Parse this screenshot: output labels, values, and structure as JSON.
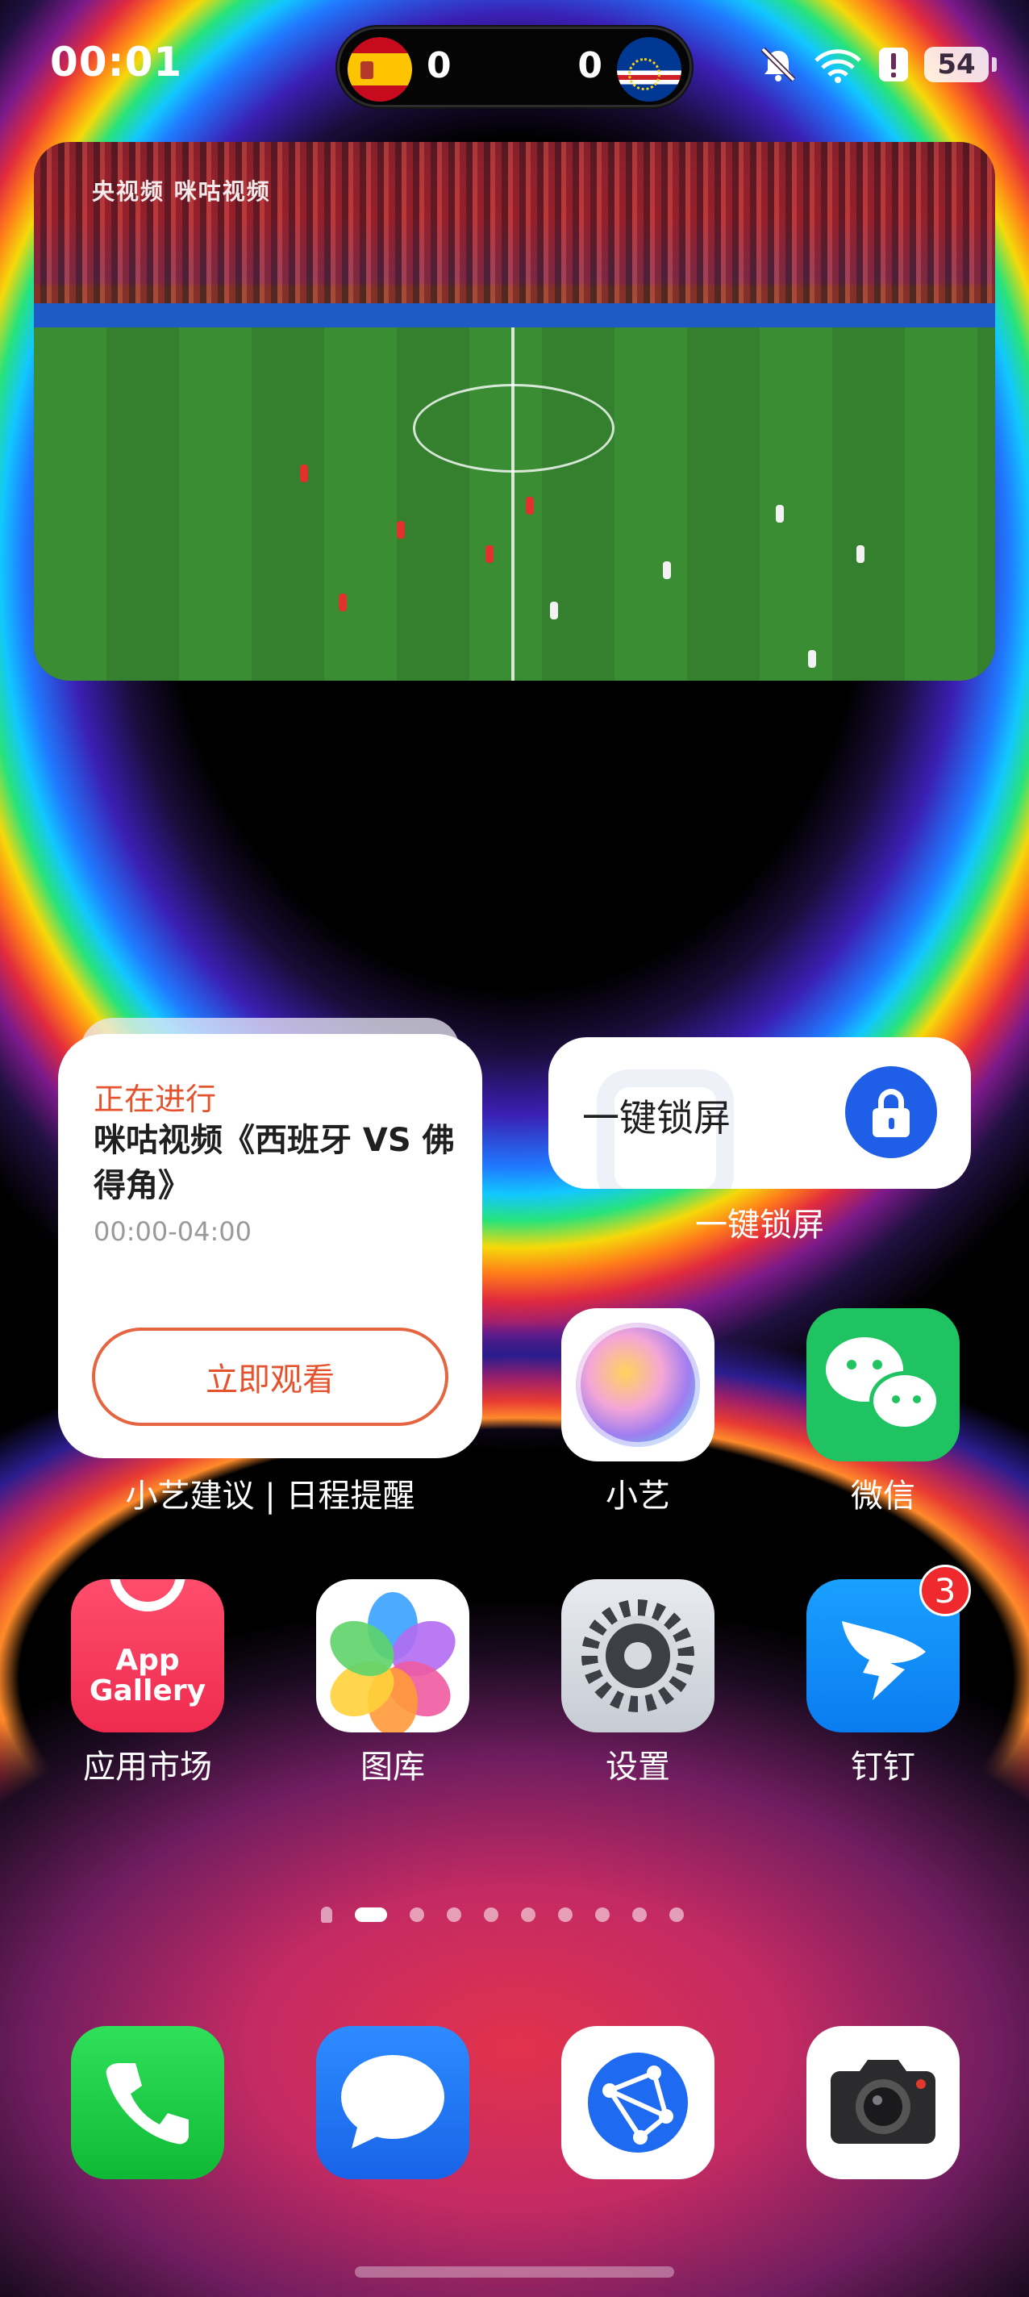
{
  "status_bar": {
    "time": "00:01",
    "live_score": {
      "home_team_flag": "spain-flag-icon",
      "home_score": "0",
      "away_score": "0",
      "away_team_flag": "cape-verde-flag-icon"
    },
    "icons": [
      "bell-off-icon",
      "wifi-icon",
      "alert-icon"
    ],
    "battery": "54"
  },
  "video_widget": {
    "watermark": "央视频 咪咕视频"
  },
  "schedule_widget": {
    "status": "正在进行",
    "title": "咪咕视频《西班牙 VS 佛得角》",
    "time_range": "00:00-04:00",
    "button_label": "立即观看",
    "caption": "小艺建议 | 日程提醒"
  },
  "lock_widget": {
    "label": "一键锁屏",
    "caption": "一键锁屏"
  },
  "apps": {
    "xiaoyi": "小艺",
    "wechat": "微信",
    "appgallery": "应用市场",
    "appgallery_icon_text": "App\nGallery",
    "gallery": "图库",
    "settings": "设置",
    "dingtalk": "钉钉",
    "dingtalk_badge": "3"
  },
  "page_indicator": {
    "count": 9,
    "active_index": 0
  },
  "dock": [
    "phone-icon",
    "messages-icon",
    "browser-icon",
    "camera-icon"
  ],
  "colors": {
    "accent_orange": "#e4532d",
    "lock_blue": "#1f5ee6",
    "badge_red": "#f0292f"
  }
}
